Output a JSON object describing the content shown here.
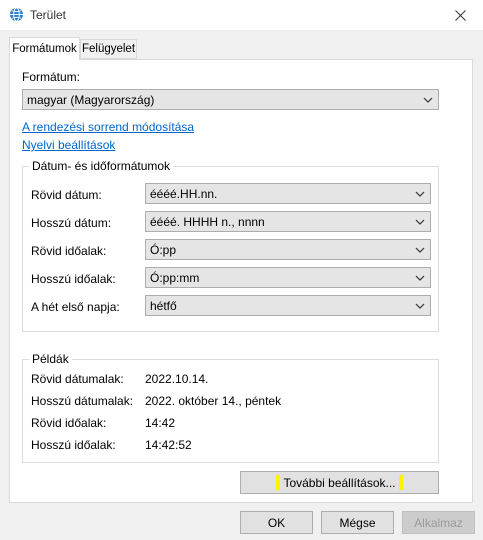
{
  "window": {
    "title": "Terület",
    "close_label": "✕"
  },
  "tabs": [
    {
      "label": "Formátumok",
      "active": true
    },
    {
      "label": "Felügyelet",
      "active": false
    }
  ],
  "format": {
    "label": "Formátum:",
    "value": "magyar (Magyarország)"
  },
  "links": {
    "sort_order": "A rendezési sorrend módosítása",
    "language_settings": "Nyelvi beállítások"
  },
  "datetime_group": {
    "title": "Dátum- és időformátumok",
    "rows": [
      {
        "label": "Rövid dátum:",
        "value": "éééé.HH.nn."
      },
      {
        "label": "Hosszú dátum:",
        "value": "éééé. HHHH n., nnnn"
      },
      {
        "label": "Rövid időalak:",
        "value": "Ó:pp"
      },
      {
        "label": "Hosszú időalak:",
        "value": "Ó:pp:mm"
      },
      {
        "label": "A hét első napja:",
        "value": "hétfő"
      }
    ]
  },
  "examples_group": {
    "title": "Példák",
    "rows": [
      {
        "label": "Rövid dátumalak:",
        "value": "2022.10.14."
      },
      {
        "label": "Hosszú dátumalak:",
        "value": "2022. október 14., péntek"
      },
      {
        "label": "Rövid időalak:",
        "value": "14:42"
      },
      {
        "label": "Hosszú időalak:",
        "value": "14:42:52"
      }
    ]
  },
  "buttons": {
    "additional": "További beállítások...",
    "ok": "OK",
    "cancel": "Mégse",
    "apply": "Alkalmaz"
  },
  "colors": {
    "link": "#0066cc",
    "highlight": "#fff200"
  },
  "icons": {
    "app": "globe-icon",
    "close": "close-icon",
    "dropdown": "chevron-down-icon"
  }
}
